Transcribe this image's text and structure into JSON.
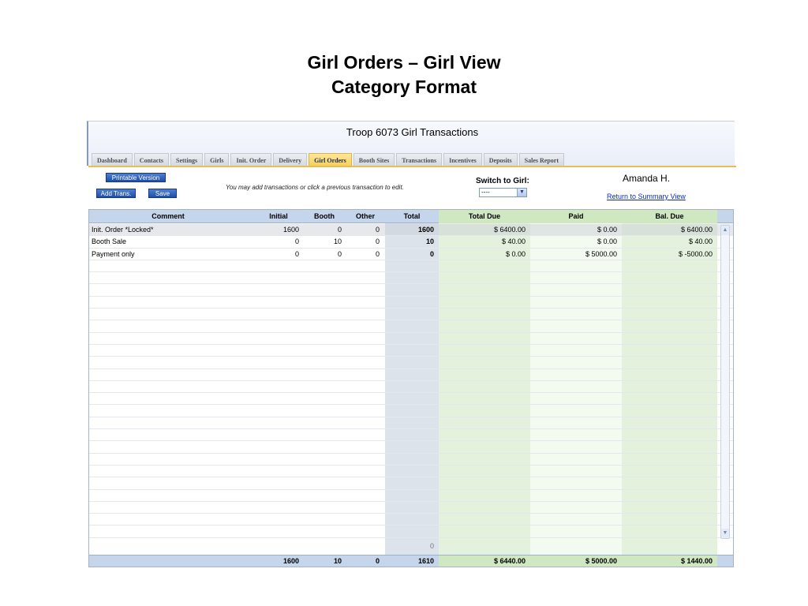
{
  "slide": {
    "title_line1": "Girl Orders – Girl View",
    "title_line2": "Category Format"
  },
  "app": {
    "title": "Troop 6073 Girl Transactions",
    "tabs": [
      "Dashboard",
      "Contacts",
      "Settings",
      "Girls",
      "Init. Order",
      "Delivery",
      "Girl Orders",
      "Booth Sites",
      "Transactions",
      "Incentives",
      "Deposits",
      "Sales Report"
    ],
    "active_tab": "Girl Orders"
  },
  "controls": {
    "printable_label": "Printable Version",
    "add_trans_label": "Add Trans.",
    "save_label": "Save",
    "hint": "You may add transactions or click a previous transaction to edit.",
    "switch_label": "Switch to Girl:",
    "switch_value": "----",
    "girl_name": "Amanda H.",
    "summary_link": "Return to Summary View"
  },
  "table": {
    "columns": [
      "Comment",
      "Initial",
      "Booth",
      "Other",
      "Total",
      "Total Due",
      "Paid",
      "Bal. Due"
    ],
    "rows": [
      [
        "Init. Order *Locked*",
        "1600",
        "0",
        "0",
        "1600",
        "$ 6400.00",
        "$ 0.00",
        "$ 6400.00"
      ],
      [
        "Booth Sale",
        "0",
        "10",
        "0",
        "10",
        "$ 40.00",
        "$ 0.00",
        "$ 40.00"
      ],
      [
        "Payment only",
        "0",
        "0",
        "0",
        "0",
        "$ 0.00",
        "$ 5000.00",
        "$ -5000.00"
      ]
    ],
    "new_row_total": "0",
    "totals": [
      "",
      "1600",
      "10",
      "0",
      "1610",
      "$ 6440.00",
      "$ 5000.00",
      "$ 1440.00"
    ]
  },
  "colors": {
    "header_blue": "#c5d5ec",
    "total_col": "#dde3ea",
    "due_green": "#e4f1dc",
    "paid_green": "#f3faf0",
    "active_tab": "#f5cf57",
    "button_blue": "#1d4fa6",
    "link": "#0a28d6"
  }
}
